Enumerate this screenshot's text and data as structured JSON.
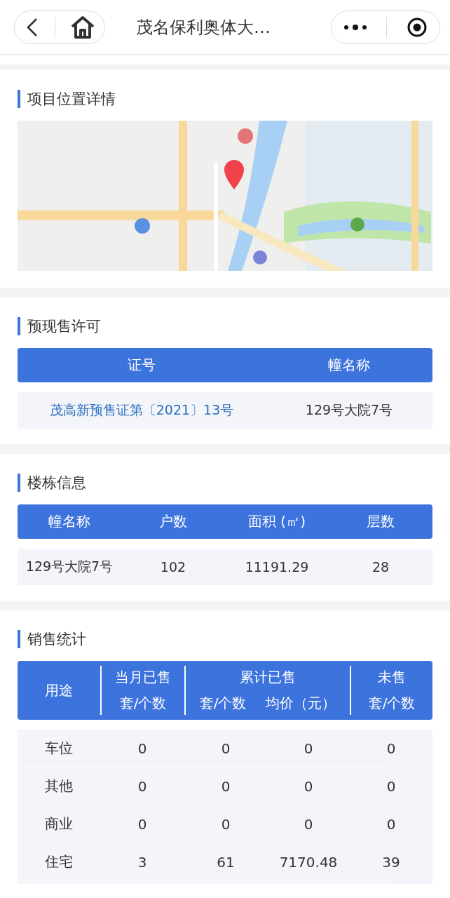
{
  "nav": {
    "title": "茂名保利奥体大…"
  },
  "location": {
    "title": "项目位置详情"
  },
  "permit": {
    "title": "预现售许可",
    "columns": [
      "证号",
      "幢名称"
    ],
    "rows": [
      {
        "permit_no": "茂高新预售证第〔2021〕13号",
        "building": "129号大院7号"
      }
    ]
  },
  "buildings": {
    "title": "楼栋信息",
    "columns": [
      "幢名称",
      "户数",
      "面积 (㎡)",
      "层数"
    ],
    "rows": [
      [
        "129号大院7号",
        "102",
        "11191.29",
        "28"
      ]
    ]
  },
  "sales": {
    "title": "销售统计",
    "header": {
      "usage": "用途",
      "month_group": "当月已售",
      "month_units": "套/个数",
      "total_group": "累计已售",
      "total_units": "套/个数",
      "total_price": "均价（元）",
      "unsold_group": "未售",
      "unsold_units": "套/个数"
    },
    "rows": [
      [
        "车位",
        "0",
        "0",
        "0",
        "0"
      ],
      [
        "其他",
        "0",
        "0",
        "0",
        "0"
      ],
      [
        "商业",
        "0",
        "0",
        "0",
        "0"
      ],
      [
        "住宅",
        "3",
        "61",
        "7170.48",
        "39"
      ]
    ]
  }
}
